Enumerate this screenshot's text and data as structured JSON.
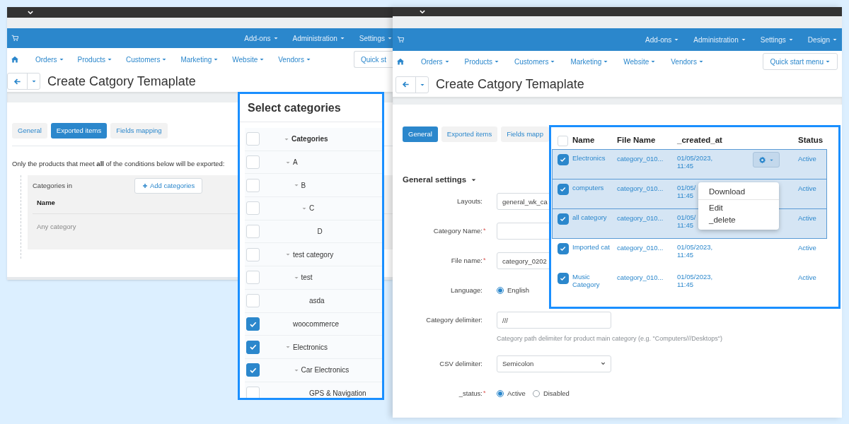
{
  "left_window": {
    "top_nav": [
      "Add-ons",
      "Administration",
      "Settings"
    ],
    "main_menu": [
      "Orders",
      "Products",
      "Customers",
      "Marketing",
      "Website",
      "Vendors"
    ],
    "quick_start_button": "Quick st",
    "page_title": "Create Catgory Temaplate",
    "tabs": [
      {
        "label": "General",
        "selected": false
      },
      {
        "label": "Exported items",
        "selected": true
      },
      {
        "label": "Fields mapping",
        "selected": false
      }
    ],
    "conditions_note": "Only the products that meet **all** of the conditions below will be exported:",
    "condition": {
      "label": "Categories in",
      "add_button": "Add categories",
      "column": "Name",
      "empty_text": "Any category"
    }
  },
  "category_picker": {
    "title": "Select categories",
    "tree": [
      {
        "label": "Categories",
        "checked": false,
        "children": [
          {
            "label": "A",
            "checked": false,
            "children": [
              {
                "label": "B",
                "checked": false,
                "children": [
                  {
                    "label": "C",
                    "checked": false,
                    "children": [
                      {
                        "label": "D",
                        "checked": false
                      }
                    ]
                  }
                ]
              }
            ]
          },
          {
            "label": "test category",
            "checked": false,
            "children": [
              {
                "label": "test",
                "checked": false,
                "children": [
                  {
                    "label": "asda",
                    "checked": false
                  }
                ]
              }
            ]
          },
          {
            "label": "woocommerce",
            "checked": true
          },
          {
            "label": "Electronics",
            "checked": true,
            "children": [
              {
                "label": "Car Electronics",
                "checked": true,
                "children": [
                  {
                    "label": "GPS & Navigation",
                    "checked": false
                  }
                ]
              }
            ]
          }
        ]
      }
    ]
  },
  "right_window": {
    "top_nav": [
      "Add-ons",
      "Administration",
      "Settings",
      "Design"
    ],
    "main_menu": [
      "Orders",
      "Products",
      "Customers",
      "Marketing",
      "Website",
      "Vendors"
    ],
    "quick_start_button": "Quick start menu",
    "page_title": "Create Catgory Temaplate",
    "tabs": [
      {
        "label": "General",
        "selected": true
      },
      {
        "label": "Exported items",
        "selected": false
      },
      {
        "label": "Fields mapp",
        "selected": false
      }
    ],
    "section_title": "General settings",
    "fields": [
      {
        "kind": "text",
        "label": "Layouts:",
        "value": "general_wk_ca"
      },
      {
        "kind": "text",
        "label": "Category Name:",
        "required_mark": "*"
      },
      {
        "kind": "text",
        "label": "File name:",
        "required_mark": "*",
        "value": "category_0202"
      },
      {
        "kind": "radio",
        "label": "Language:",
        "options": [
          {
            "label": "English",
            "selected": true
          }
        ]
      },
      {
        "kind": "text",
        "label": "Category delimiter:",
        "value": "///",
        "help": "Category path delimiter for product main category (e.g. \"Computers///Desktops\")"
      },
      {
        "kind": "select",
        "label": "CSV delimiter:",
        "value": "Semicolon"
      },
      {
        "kind": "radio",
        "label": "_status:",
        "required_mark": "*",
        "options": [
          {
            "label": "Active",
            "selected": true
          },
          {
            "label": "Disabled",
            "selected": false
          }
        ]
      }
    ]
  },
  "templates_table": {
    "header_checked": false,
    "columns": [
      "Name",
      "File Name",
      "_created_at",
      "Status"
    ],
    "rows": [
      {
        "name": "Electronics",
        "file": "category_010...",
        "date": "01/05/2023,",
        "time": "11:45",
        "status": "Active",
        "checked": true,
        "selected": true,
        "actions_button": true
      },
      {
        "name": "computers",
        "file": "category_010...",
        "date": "01/05/",
        "time": "11:45",
        "status": "Active",
        "checked": true,
        "selected": true,
        "actions_button": false
      },
      {
        "name": "all category",
        "file": "category_010...",
        "date": "01/05/",
        "time": "11:45",
        "status": "Active",
        "checked": true,
        "selected": true,
        "actions_button": false
      },
      {
        "name": "Imported cat",
        "file": "category_010...",
        "date": "01/05/2023,",
        "time": "11:45",
        "status": "Active",
        "checked": true,
        "selected": false,
        "actions_button": false
      },
      {
        "name": "Music Category",
        "file": "category_010...",
        "date": "01/05/2023,",
        "time": "11:45",
        "status": "Active",
        "checked": true,
        "selected": false,
        "actions_button": false
      }
    ],
    "menu": [
      {
        "label": "Download",
        "divider_after": true
      },
      {
        "label": "Edit",
        "divider_after": false
      },
      {
        "label": "_delete",
        "divider_after": false
      }
    ]
  }
}
